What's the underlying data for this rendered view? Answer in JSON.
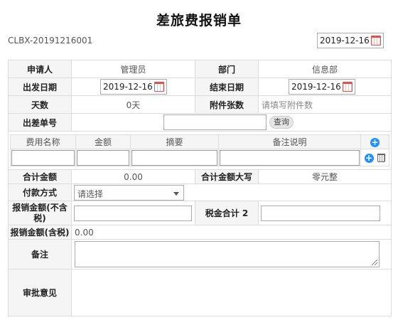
{
  "title": "差旅费报销单",
  "doc_no": "CLBX-20191216001",
  "top_date": "2019-12-16",
  "fields": {
    "applicant_label": "申请人",
    "applicant_value": "管理员",
    "dept_label": "部门",
    "dept_value": "信息部",
    "depart_date_label": "出发日期",
    "depart_date_value": "2019-12-16",
    "end_date_label": "结束日期",
    "end_date_value": "2019-12-16",
    "days_label": "天数",
    "days_value": "0天",
    "attach_label": "附件张数",
    "attach_placeholder": "请填写附件数",
    "trip_no_label": "出差单号",
    "query_label": "查询",
    "total_label": "合计金额",
    "total_value": "0.00",
    "total_upper_label": "合计金额大写",
    "total_upper_value": "零元整",
    "pay_method_label": "付款方式",
    "pay_method_value": "请选择",
    "amount_ex_tax_label": "报销金额(不含税)",
    "tax_total_label": "税金合计 2",
    "amount_inc_tax_label": "报销金额(含税)",
    "amount_inc_tax_value": "0.00",
    "remark_label": "备注",
    "approval_label": "审批意见"
  },
  "expense_table": {
    "headers": [
      "费用名称",
      "金额",
      "摘要",
      "备注说明"
    ]
  },
  "icons": {
    "calendar": "calendar-icon",
    "add": "plus-circle-icon",
    "delete": "trash-icon",
    "dropdown": "caret-down-icon"
  },
  "colors": {
    "accent": "#1e90ff",
    "label_bg": "#f5f5f5",
    "border": "#dcdcdc"
  }
}
